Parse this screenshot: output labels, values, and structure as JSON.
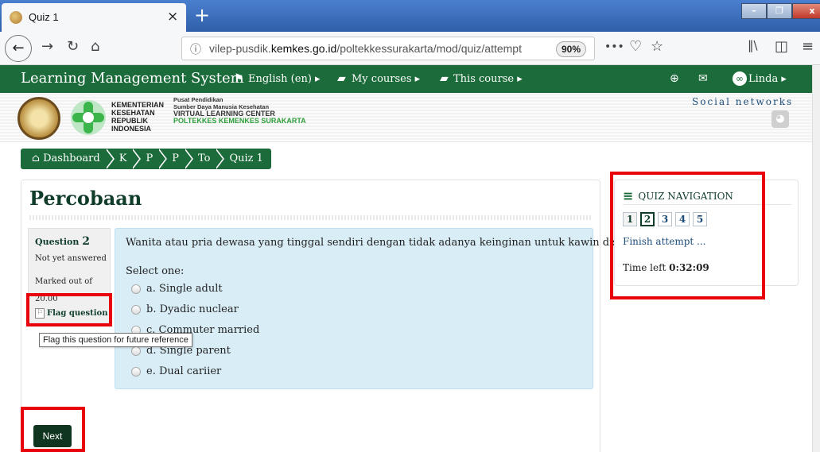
{
  "browser": {
    "tab_title": "Quiz 1",
    "tab_close": "×",
    "new_tab": "+",
    "url_info_icon": "ⓘ",
    "url_prefix": "vilep-pusdik.",
    "url_host": "kemkes.go.id",
    "url_path": "/poltekkessurakarta/mod/quiz/attempt",
    "zoom": "90%",
    "window_buttons": [
      "–",
      "❐",
      "x"
    ],
    "icons": [
      "back-icon",
      "forward-icon",
      "reload-icon",
      "home-icon",
      "more-icon",
      "pocket-icon",
      "bookmark-star-icon",
      "library-icon",
      "sidebar-icon",
      "menu-icon"
    ]
  },
  "lms": {
    "brand": "Learning Management System",
    "menus": [
      "▶ English (en) ▸",
      "My courses ▸",
      "This course ▸"
    ],
    "language": "English (en) ▸",
    "my_courses": "My courses ▸",
    "this_course": "This course ▸",
    "user": "Linda ▸"
  },
  "banner": {
    "kemkes_lines": [
      "KEMENTERIAN",
      "KESEHATAN",
      "REPUBLIK",
      "INDONESIA"
    ],
    "pusdik_line1": "Pusat Pendidikan",
    "pusdik_line2": "Sumber Daya Manusia Kesehatan",
    "vlc": "VIRTUAL LEARNING CENTER",
    "poltekkes": "POLTEKKES KEMENKES SURAKARTA",
    "social": "Social networks"
  },
  "breadcrumb": [
    "Dashboard",
    "K",
    "P",
    "P",
    "To",
    "Quiz 1"
  ],
  "quiz": {
    "title": "Percobaan",
    "question_label": "Question",
    "question_number": "2",
    "state": "Not yet answered",
    "marked_out_of": "Marked out of 20.00",
    "flag_label": "Flag question",
    "question_text": "Wanita atau pria dewasa yang tinggal sendiri dengan tidak adanya keinginan untuk kawin disebut?",
    "select_one": "Select one:",
    "options": [
      "a. Single adult",
      "b. Dyadic nuclear",
      "c. Commuter married",
      "d. Single parent",
      "e. Dual cariier"
    ],
    "next": "Next",
    "tooltip": "Flag this question for future reference"
  },
  "quiz_nav": {
    "title": "QUIZ NAVIGATION",
    "buttons": [
      "1",
      "2",
      "3",
      "4",
      "5"
    ],
    "current": "2",
    "finish": "Finish attempt ...",
    "time_label": "Time left",
    "time_value": "0:32:09"
  },
  "colors": {
    "lms_green": "#1c6b3a",
    "title_green": "#0f3d2a",
    "highlight_red": "#e8000b",
    "question_bg": "#d9edf7"
  }
}
